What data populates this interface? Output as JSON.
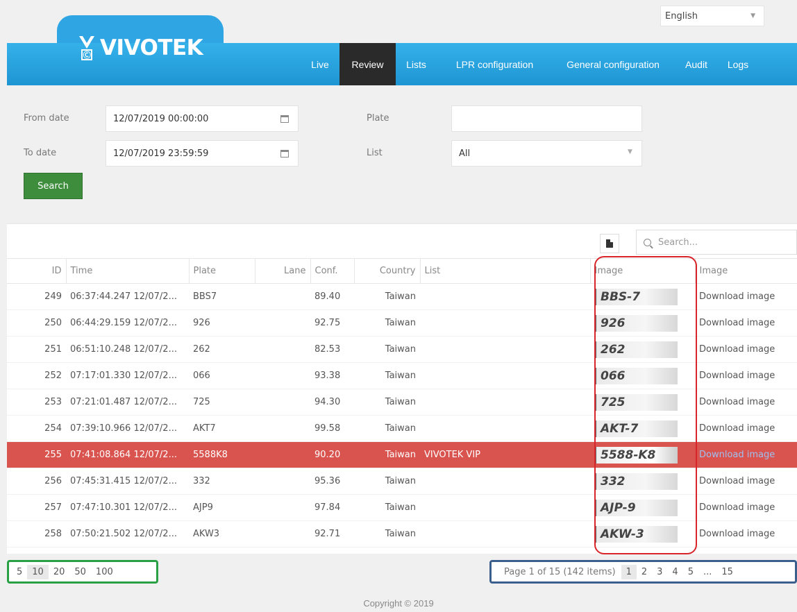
{
  "language": {
    "selected": "English"
  },
  "brand": {
    "logo_text": "VIVOTEK"
  },
  "nav": {
    "items": [
      "Live",
      "Review",
      "Lists",
      "LPR configuration",
      "General configuration",
      "Audit",
      "Logs"
    ],
    "active": "Review"
  },
  "filters": {
    "from_date_label": "From date",
    "from_date_value": "12/07/2019 00:00:00",
    "to_date_label": "To date",
    "to_date_value": "12/07/2019 23:59:59",
    "plate_label": "Plate",
    "plate_value": "",
    "list_label": "List",
    "list_value": "All",
    "search_button": "Search"
  },
  "grid": {
    "search_placeholder": "Search...",
    "columns": [
      "ID",
      "Time",
      "Plate",
      "Lane",
      "Conf.",
      "Country",
      "List",
      "Image",
      "Image"
    ],
    "rows": [
      {
        "id": "249",
        "time": "06:37:44.247 12/07/2...",
        "plate": "BBS7",
        "lane": "",
        "conf": "89.40",
        "country": "Taiwan",
        "list": "",
        "image": "BBS-7",
        "link": "Download image"
      },
      {
        "id": "250",
        "time": "06:44:29.159 12/07/2...",
        "plate": "926",
        "lane": "",
        "conf": "92.75",
        "country": "Taiwan",
        "list": "",
        "image": "926",
        "link": "Download image"
      },
      {
        "id": "251",
        "time": "06:51:10.248 12/07/2...",
        "plate": "262",
        "lane": "",
        "conf": "82.53",
        "country": "Taiwan",
        "list": "",
        "image": "262",
        "link": "Download image"
      },
      {
        "id": "252",
        "time": "07:17:01.330 12/07/2...",
        "plate": "066",
        "lane": "",
        "conf": "93.38",
        "country": "Taiwan",
        "list": "",
        "image": "066",
        "link": "Download image"
      },
      {
        "id": "253",
        "time": "07:21:01.487 12/07/2...",
        "plate": "725",
        "lane": "",
        "conf": "94.30",
        "country": "Taiwan",
        "list": "",
        "image": "725",
        "link": "Download image"
      },
      {
        "id": "254",
        "time": "07:39:10.966 12/07/2...",
        "plate": "AKT7",
        "lane": "",
        "conf": "99.58",
        "country": "Taiwan",
        "list": "",
        "image": "AKT-7",
        "link": "Download image"
      },
      {
        "id": "255",
        "time": "07:41:08.864 12/07/2...",
        "plate": "5588K8",
        "lane": "",
        "conf": "90.20",
        "country": "Taiwan",
        "list": "VIVOTEK VIP",
        "image": "5588-K8",
        "link": "Download image",
        "highlighted": true
      },
      {
        "id": "256",
        "time": "07:45:31.415 12/07/2...",
        "plate": "332",
        "lane": "",
        "conf": "95.36",
        "country": "Taiwan",
        "list": "",
        "image": "332",
        "link": "Download image"
      },
      {
        "id": "257",
        "time": "07:47:10.301 12/07/2...",
        "plate": "AJP9",
        "lane": "",
        "conf": "97.84",
        "country": "Taiwan",
        "list": "",
        "image": "AJP-9",
        "link": "Download image"
      },
      {
        "id": "258",
        "time": "07:50:21.502 12/07/2...",
        "plate": "AKW3",
        "lane": "",
        "conf": "92.71",
        "country": "Taiwan",
        "list": "",
        "image": "AKW-3",
        "link": "Download image"
      }
    ]
  },
  "page_sizes": {
    "options": [
      "5",
      "10",
      "20",
      "50",
      "100"
    ],
    "selected": "10"
  },
  "pager": {
    "info": "Page 1 of 15 (142 items)",
    "pages": [
      "1",
      "2",
      "3",
      "4",
      "5",
      "...",
      "15"
    ],
    "current": "1"
  },
  "footer": {
    "copyright": "Copyright © 2019"
  },
  "colors": {
    "nav_blue": "#2fa6e3",
    "active_tab": "#2a2a2a",
    "highlight_row": "#d9534f",
    "search_green": "#3d8d3d",
    "link_blue": "#2a8ad8"
  }
}
